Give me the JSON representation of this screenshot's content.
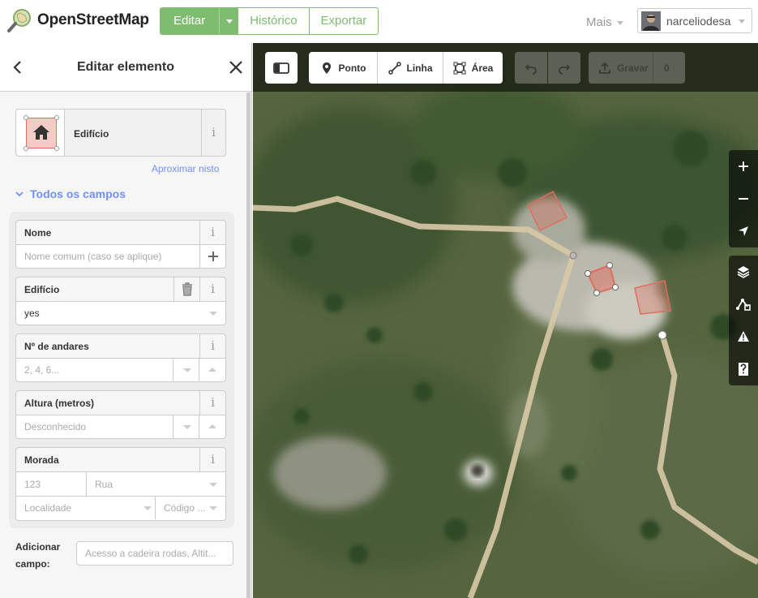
{
  "header": {
    "logo_text": "OpenStreetMap",
    "tabs": [
      {
        "label": "Editar",
        "active": true
      },
      {
        "label": "Histórico",
        "active": false
      },
      {
        "label": "Exportar",
        "active": false
      }
    ],
    "more_label": "Mais",
    "username": "narceliodesa",
    "accent_color": "#7ebc6f"
  },
  "sidebar": {
    "title": "Editar elemento",
    "back_icon": "chevron-left-icon",
    "close_icon": "close-icon",
    "preset": {
      "name": "Edifício",
      "icon": "house-icon",
      "info": "i"
    },
    "zoom_link": "Aproximar nisto",
    "section_title": "Todos os campos",
    "fields": {
      "nome": {
        "label": "Nome",
        "placeholder": "Nome comum (caso se aplique)"
      },
      "edificio": {
        "label": "Edifício",
        "value": "yes"
      },
      "andares": {
        "label": "Nº de andares",
        "placeholder": "2, 4, 6..."
      },
      "altura": {
        "label": "Altura (metros)",
        "placeholder": "Desconhecido"
      },
      "morada": {
        "label": "Morada",
        "number_placeholder": "123",
        "street_placeholder": "Rua",
        "locality_placeholder": "Localidade",
        "postcode_placeholder": "Código ..."
      }
    },
    "add_field": {
      "label": "Adicionar campo:",
      "placeholder": "Acesso a cadeira rodas, Altit..."
    },
    "link_color": "#7092ff"
  },
  "map_toolbar": {
    "sidebar_toggle_icon": "sidebar-toggle-icon",
    "point_label": "Ponto",
    "line_label": "Linha",
    "area_label": "Área",
    "undo_icon": "undo-icon",
    "redo_icon": "redo-icon",
    "save_label": "Gravar",
    "save_count": "0"
  },
  "map_controls": {
    "zoom_in": "zoom-in-icon",
    "zoom_out": "zoom-out-icon",
    "geolocate": "geolocate-icon",
    "layers": "layers-icon",
    "map_data": "map-data-icon",
    "issues": "issues-icon",
    "help": "help-icon"
  }
}
